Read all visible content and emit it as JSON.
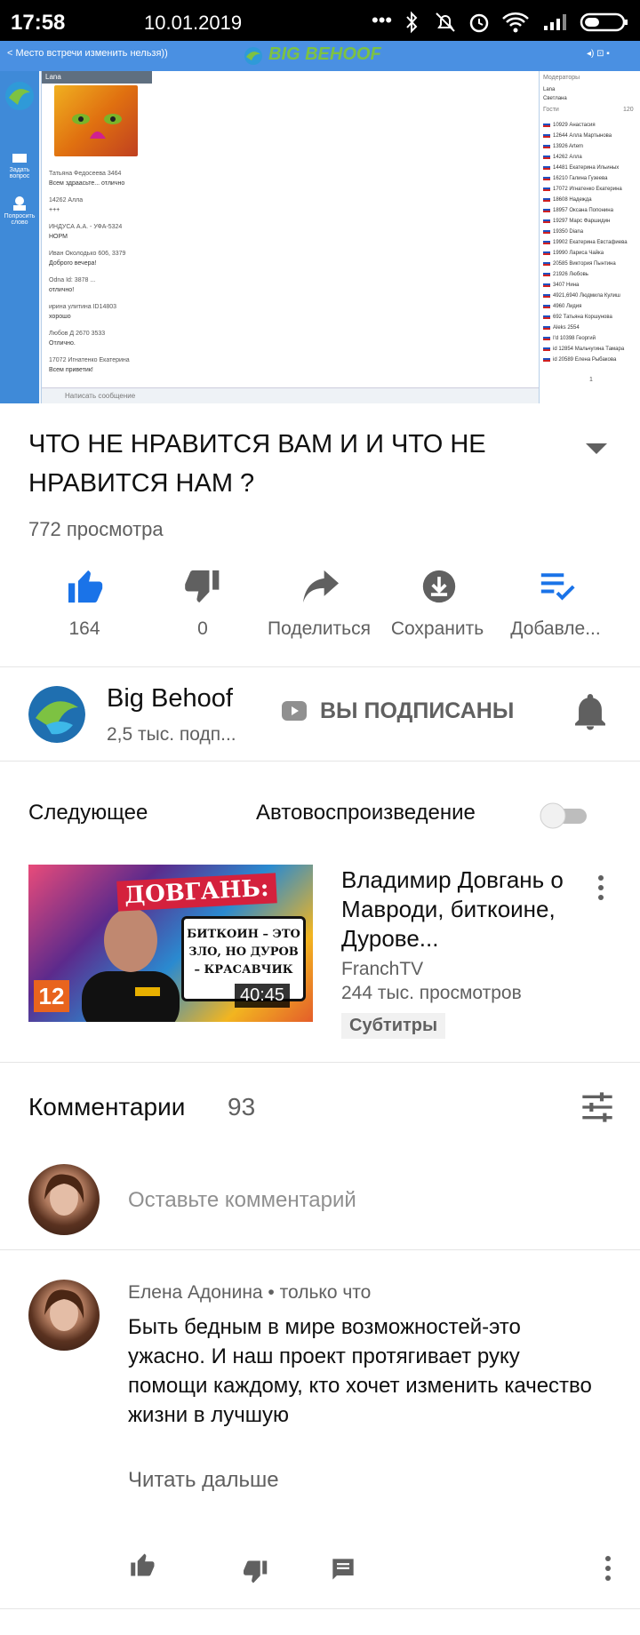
{
  "status_bar": {
    "time": "17:58",
    "date": "10.01.2019"
  },
  "player": {
    "caption": "< Место встречи изменить нельзя))",
    "logo": "BIG BEHOOF",
    "left_actions": [
      "Задать вопрос",
      "Попросить слово"
    ],
    "chat_header": "Lana",
    "messages": [
      {
        "name": "Татьяна Федосеева 3464",
        "text": "Всем здраасьте... отлично"
      },
      {
        "name": "14262 Алла",
        "text": "+++"
      },
      {
        "name": "ИНДУСА А.А. - УФА-5324",
        "text": "НОРМ"
      },
      {
        "name": "Иван Околодько 606, 3379",
        "text": "Доброго вечера!"
      },
      {
        "name": "Odna Id: 3878 ...",
        "text": "отлично!"
      },
      {
        "name": "ирина улитина ID14803",
        "text": "хорошо"
      },
      {
        "name": "Любов Д 2670 3533",
        "text": "Отлично."
      },
      {
        "name": "17072 Игнатенко Екатерина",
        "text": "Всем приветик!"
      }
    ],
    "input_placeholder": "Написать сообщение",
    "right_header": "Модераторы",
    "moderators": [
      "Lana",
      "Светлана"
    ],
    "guests_label": "Гости",
    "guests_count": "120",
    "users": [
      "10929 Анастасия",
      "12644 Алла Мартынова",
      "13926 Artem",
      "14262 Алла",
      "14481 Екатерина Ильиных",
      "16210 Галина Гузеева",
      "17072 Игнатенко Екатерина",
      "18608 Надежда",
      "18957 Оксана Попонина",
      "19297 Марс Фаршидин",
      "19350 Diana",
      "19902 Екатерина Евстафиева",
      "19990 Лариса Чайка",
      "20585 Виктория Пынтина",
      "21926 Любовь",
      "3407 Нина",
      "4921,6940 Людмила Кулиш",
      "4960 Лидия",
      "692 Татьяна Коршунова",
      "Aleks 2554",
      "I'd 10398 Георгий",
      "id 12854 Мальчугина Тамара",
      "id 20589 Елена Рыбакова"
    ],
    "page": "1"
  },
  "video": {
    "title": "ЧТО НЕ НРАВИТСЯ ВАМ И И ЧТО НЕ НРАВИТСЯ НАМ ?",
    "views": "772 просмотра"
  },
  "actions": [
    {
      "label": "164",
      "icon": "thumbs-up-icon"
    },
    {
      "label": "0",
      "icon": "thumbs-down-icon"
    },
    {
      "label": "Поделиться",
      "icon": "share-icon"
    },
    {
      "label": "Сохранить",
      "icon": "download-icon"
    },
    {
      "label": "Добавле...",
      "icon": "add-to-playlist-icon"
    }
  ],
  "channel": {
    "name": "Big Behoof",
    "subs": "2,5 тыс. подп...",
    "subscribed_label": "ВЫ ПОДПИСАНЫ"
  },
  "up_next": {
    "label": "Следующее",
    "autoplay_label": "Автовоспроизведение",
    "autoplay_on": false,
    "video": {
      "title": "Владимир Довгань о Мавроди, биткоине, Дурове...",
      "channel": "FranchTV",
      "views": "244 тыс. просмотров",
      "badge": "Субтитры",
      "duration": "40:45",
      "thumb_headline": "ДОВГАНЬ:",
      "thumb_bubble": "БИТКОИН – ЭТО ЗЛО, НО ДУРОВ – КРАСАВЧИК",
      "thumb_number": "12"
    }
  },
  "comments": {
    "title": "Комментарии",
    "count": "93",
    "add_placeholder": "Оставьте комментарий",
    "items": [
      {
        "author": "Елена Адонина • только что",
        "text": "Быть бедным в мире возможностей-это ужасно. И наш проект протягивает руку помощи каждому, кто хочет изменить качество жизни в лучшую",
        "read_more": "Читать дальше"
      }
    ]
  },
  "colors": {
    "accent": "#1a73e8",
    "icon_gray": "#606060"
  }
}
